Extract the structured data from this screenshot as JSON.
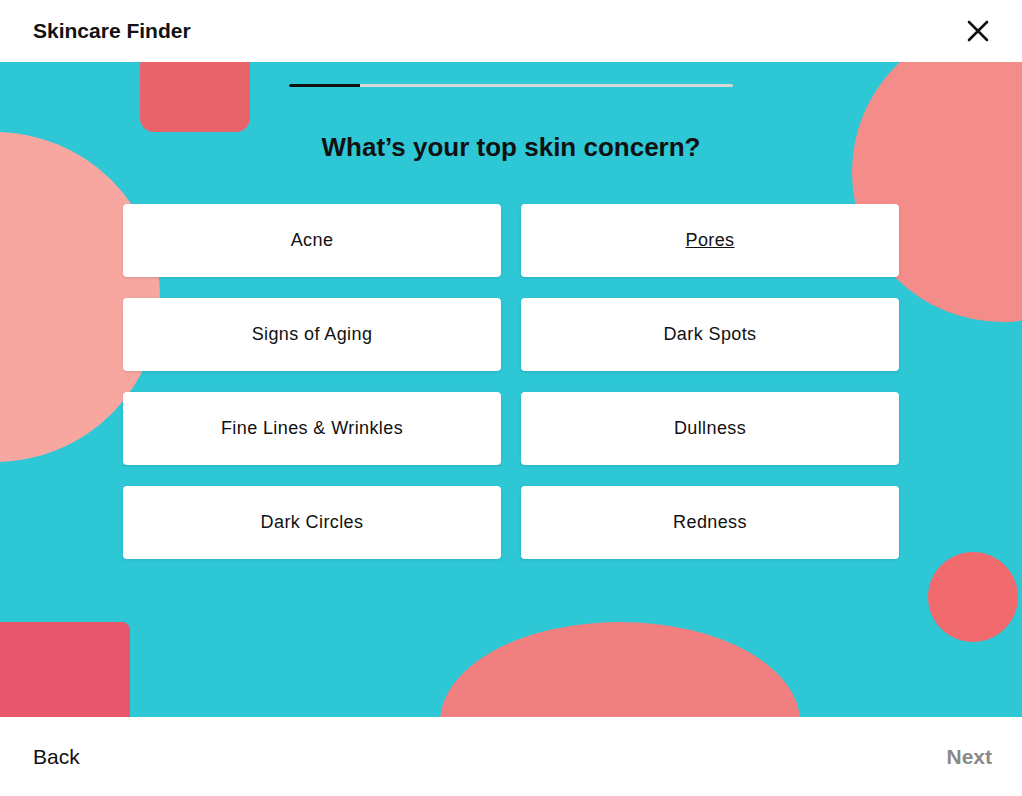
{
  "header": {
    "title": "Skincare Finder"
  },
  "progress": {
    "level": 0.16
  },
  "question": "What’s your top skin concern?",
  "options": [
    {
      "label": "Acne",
      "selected": false,
      "hovered": false
    },
    {
      "label": "Pores",
      "selected": false,
      "hovered": true
    },
    {
      "label": "Signs of Aging",
      "selected": false,
      "hovered": false
    },
    {
      "label": "Dark Spots",
      "selected": false,
      "hovered": false
    },
    {
      "label": "Fine Lines & Wrinkles",
      "selected": false,
      "hovered": false
    },
    {
      "label": "Dullness",
      "selected": false,
      "hovered": false
    },
    {
      "label": "Dark Circles",
      "selected": false,
      "hovered": false
    },
    {
      "label": "Redness",
      "selected": false,
      "hovered": false
    }
  ],
  "footer": {
    "back": "Back",
    "next": "Next",
    "next_disabled": true
  }
}
